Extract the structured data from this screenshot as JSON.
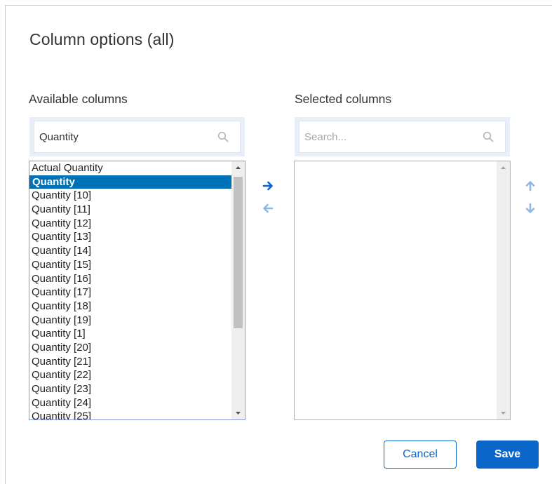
{
  "dialog": {
    "title": "Column options (all)",
    "cancel_label": "Cancel",
    "save_label": "Save"
  },
  "available": {
    "label": "Available columns",
    "search_value": "Quantity",
    "items": [
      "Actual Quantity",
      "Quantity",
      "Quantity [10]",
      "Quantity [11]",
      "Quantity [12]",
      "Quantity [13]",
      "Quantity [14]",
      "Quantity [15]",
      "Quantity [16]",
      "Quantity [17]",
      "Quantity [18]",
      "Quantity [19]",
      "Quantity [1]",
      "Quantity [20]",
      "Quantity [21]",
      "Quantity [22]",
      "Quantity [23]",
      "Quantity [24]",
      "Quantity [25]"
    ],
    "selected_item": "Quantity"
  },
  "selected": {
    "label": "Selected columns",
    "search_placeholder": "Search...",
    "items": []
  },
  "icons": {
    "search": "search-icon",
    "move_right": "arrow-right-icon",
    "move_left": "arrow-left-icon",
    "move_up": "arrow-up-icon",
    "move_down": "arrow-down-icon"
  },
  "colors": {
    "accent": "#0a67c9",
    "selection": "#0073b8",
    "search_frame": "#e9eff8",
    "disabled_arrow": "#8fb8e8"
  }
}
